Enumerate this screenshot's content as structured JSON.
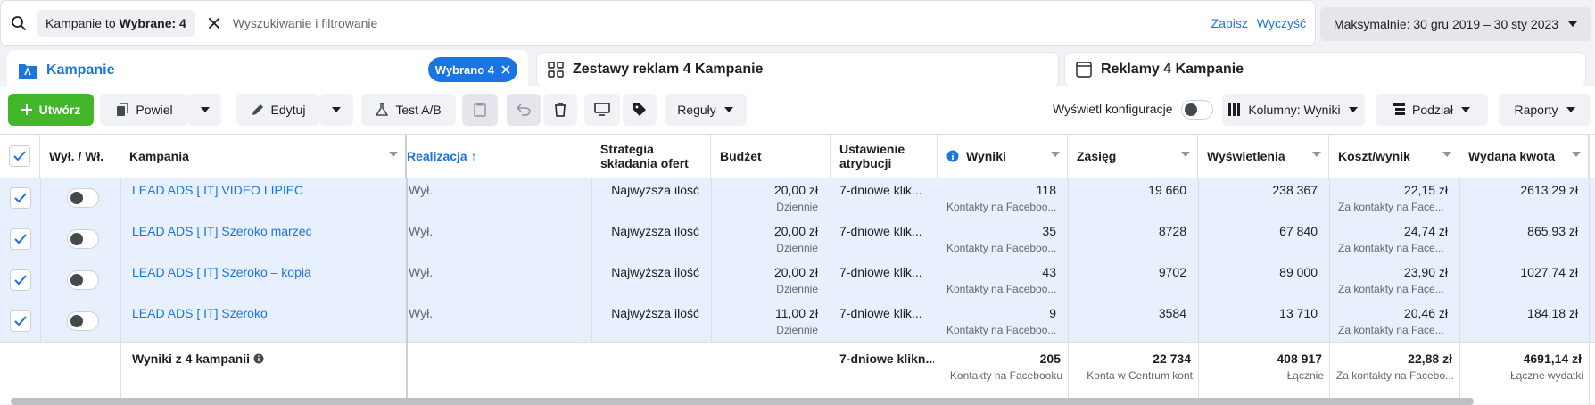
{
  "search": {
    "filter_chip_prefix": "Kampanie to",
    "filter_chip_value": "Wybrane: 4",
    "placeholder": "Wyszukiwanie i filtrowanie",
    "save_label": "Zapisz",
    "clear_label": "Wyczyść"
  },
  "date_range": "Maksymalnie: 30 gru 2019 – 30 sty 2023",
  "tabs": {
    "campaigns": {
      "label": "Kampanie",
      "selected_label": "Wybrano 4"
    },
    "adsets": {
      "label": "Zestawy reklam 4 Kampanie"
    },
    "ads": {
      "label": "Reklamy 4 Kampanie"
    }
  },
  "toolbar": {
    "create_label": "Utwórz",
    "duplicate_label": "Powiel",
    "edit_label": "Edytuj",
    "ab_test_label": "Test A/B",
    "rules_label": "Reguły",
    "show_config_label": "Wyświetl konfiguracje",
    "columns_label": "Kolumny: Wyniki",
    "breakdown_label": "Podział",
    "reports_label": "Raporty"
  },
  "columns": {
    "onoff": "Wył. / Wł.",
    "campaign": "Kampania",
    "delivery": "Realizacja ↑",
    "bid_strategy": "Strategia składania ofert",
    "budget": "Budżet",
    "attribution": "Ustawienie atrybucji",
    "results": "Wyniki",
    "reach": "Zasięg",
    "impressions": "Wyświetlenia",
    "cost_per_result": "Koszt/wynik",
    "amount_spent": "Wydana kwota"
  },
  "rows": [
    {
      "name": "LEAD ADS [ IT] VIDEO LIPIEC",
      "delivery": "Wył.",
      "bid": "Najwyższa ilość",
      "budget": "20,00 zł",
      "budget_sub": "Dziennie",
      "attribution": "7-dniowe klik...",
      "results": "118",
      "results_sub": "Kontakty na Faceboo...",
      "reach": "19 660",
      "impressions": "238 367",
      "cpr": "22,15 zł",
      "cpr_sub": "Za kontakty na Face...",
      "spent": "2613,29 zł"
    },
    {
      "name": "LEAD ADS [ IT] Szeroko marzec",
      "delivery": "Wył.",
      "bid": "Najwyższa ilość",
      "budget": "20,00 zł",
      "budget_sub": "Dziennie",
      "attribution": "7-dniowe klik...",
      "results": "35",
      "results_sub": "Kontakty na Faceboo...",
      "reach": "8728",
      "impressions": "67 840",
      "cpr": "24,74 zł",
      "cpr_sub": "Za kontakty na Face...",
      "spent": "865,93 zł"
    },
    {
      "name": "LEAD ADS [ IT] Szeroko – kopia",
      "delivery": "Wył.",
      "bid": "Najwyższa ilość",
      "budget": "20,00 zł",
      "budget_sub": "Dziennie",
      "attribution": "7-dniowe klik...",
      "results": "43",
      "results_sub": "Kontakty na Faceboo...",
      "reach": "9702",
      "impressions": "89 000",
      "cpr": "23,90 zł",
      "cpr_sub": "Za kontakty na Face...",
      "spent": "1027,74 zł"
    },
    {
      "name": "LEAD ADS [ IT] Szeroko",
      "delivery": "Wył.",
      "bid": "Najwyższa ilość",
      "budget": "11,00 zł",
      "budget_sub": "Dziennie",
      "attribution": "7-dniowe klik...",
      "results": "9",
      "results_sub": "Kontakty na Faceboo...",
      "reach": "3584",
      "impressions": "13 710",
      "cpr": "20,46 zł",
      "cpr_sub": "Za kontakty na Face...",
      "spent": "184,18 zł"
    }
  ],
  "totals": {
    "label": "Wyniki z 4 kampanii",
    "attribution": "7-dniowe klikn...",
    "results": "205",
    "results_sub": "Kontakty na Facebooku",
    "reach": "22 734",
    "reach_sub": "Konta w Centrum kont",
    "impressions": "408 917",
    "impressions_sub": "Łącznie",
    "cpr": "22,88 zł",
    "cpr_sub": "Za kontakty na Facebo...",
    "spent": "4691,14 zł",
    "spent_sub": "Łączne wydatki"
  },
  "colors": {
    "accent": "#1b74e4",
    "create": "#42b72a",
    "selected_row": "#e7f0fc"
  }
}
